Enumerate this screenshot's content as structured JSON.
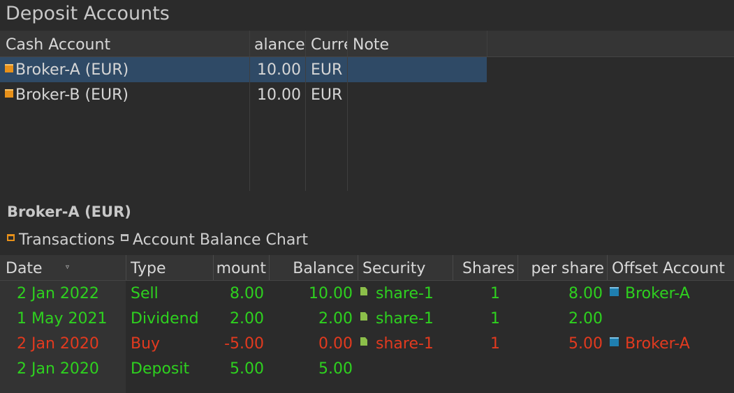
{
  "title": "Deposit Accounts",
  "accounts": {
    "headers": [
      "Cash Account",
      "alance",
      "Currе",
      "Note"
    ],
    "rows": [
      {
        "name": "Broker-A (EUR)",
        "balance": "10.00",
        "currency": "EUR",
        "note": "",
        "selected": true
      },
      {
        "name": "Broker-B (EUR)",
        "balance": "10.00",
        "currency": "EUR",
        "note": "",
        "selected": false
      }
    ]
  },
  "detail": {
    "title": "Broker-A (EUR)",
    "tabs": [
      {
        "label": "Transactions",
        "icon": "transactions-icon"
      },
      {
        "label": "Account Balance Chart",
        "icon": "chart-icon"
      }
    ]
  },
  "transactions": {
    "headers": [
      "Date",
      "Type",
      "mount",
      "Balance",
      "Security",
      "Shares",
      "per share",
      "Offset Account"
    ],
    "rows": [
      {
        "date": "2 Jan 2022",
        "type": "Sell",
        "amount": "8.00",
        "balance": "10.00",
        "security": "share-1",
        "shares": "1",
        "per_share": "8.00",
        "offset": "Broker-A",
        "color": "green"
      },
      {
        "date": "1 May 2021",
        "type": "Dividend",
        "amount": "2.00",
        "balance": "2.00",
        "security": "share-1",
        "shares": "1",
        "per_share": "2.00",
        "offset": "",
        "color": "green"
      },
      {
        "date": "2 Jan 2020",
        "type": "Buy",
        "amount": "-5.00",
        "balance": "0.00",
        "security": "share-1",
        "shares": "1",
        "per_share": "5.00",
        "offset": "Broker-A",
        "color": "red"
      },
      {
        "date": "2 Jan 2020",
        "type": "Deposit",
        "amount": "5.00",
        "balance": "5.00",
        "security": "",
        "shares": "",
        "per_share": "",
        "offset": "",
        "color": "green"
      }
    ]
  }
}
